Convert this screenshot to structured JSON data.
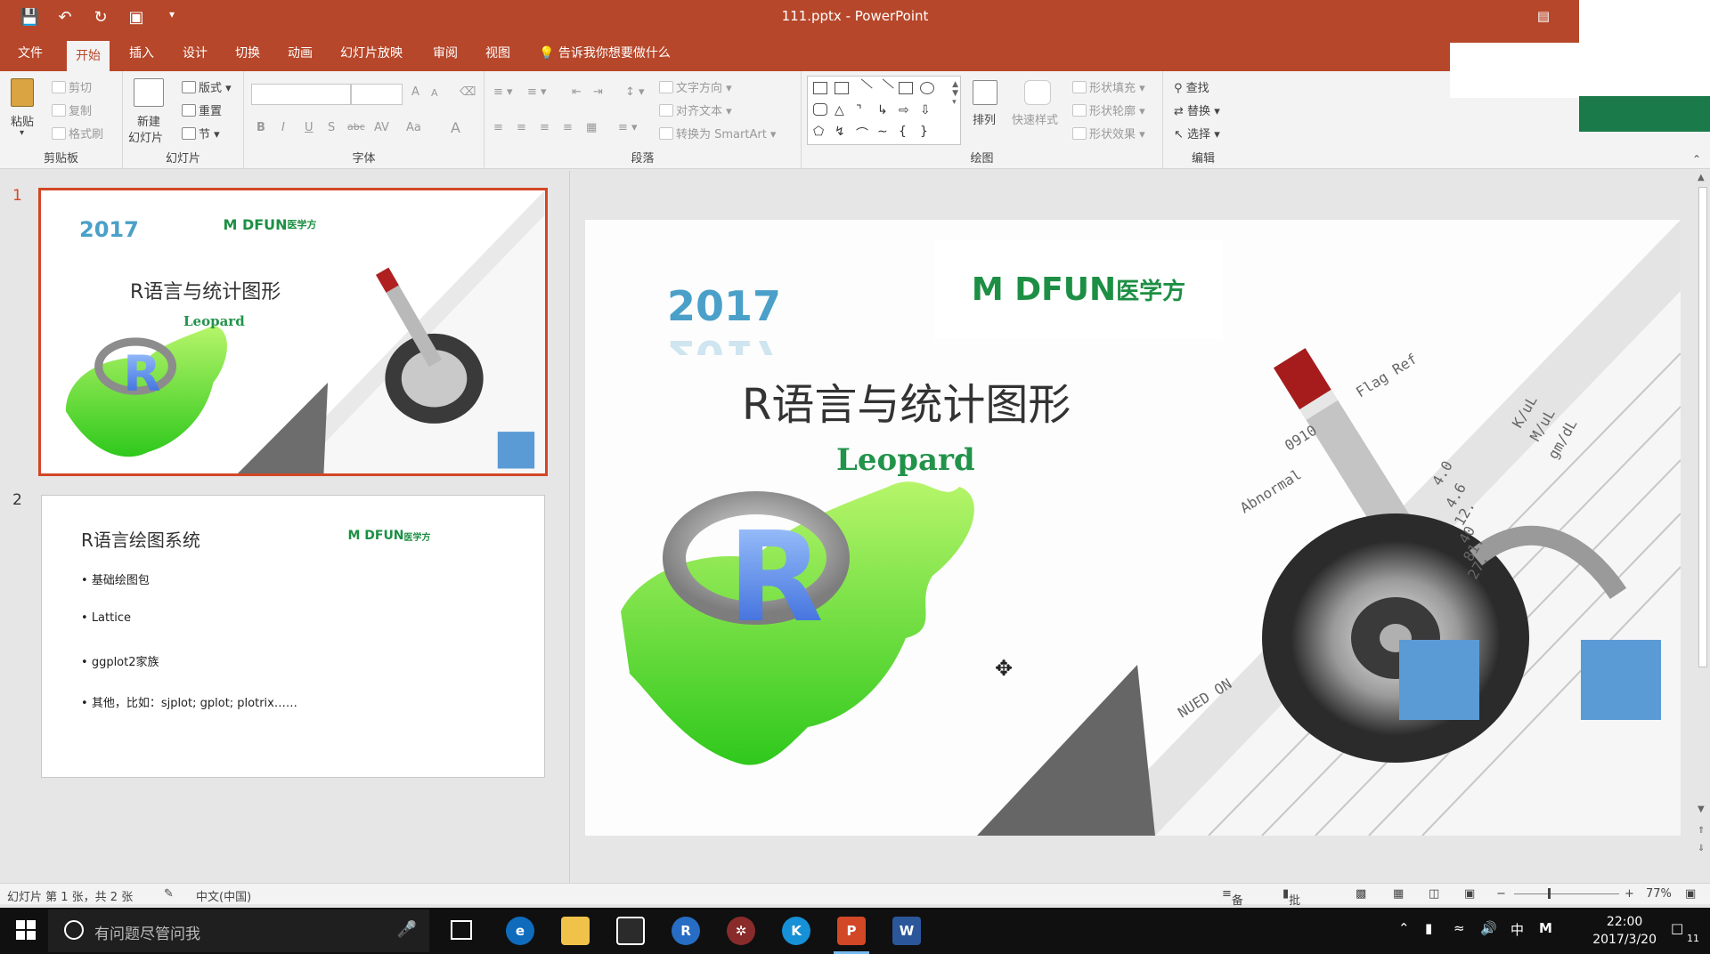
{
  "titlebar": {
    "doc_title": "111.pptx",
    "separator": "-",
    "app_name": "PowerPoint",
    "restore_icon": "ribbon-display-icon"
  },
  "tabs": [
    "文件",
    "开始",
    "插入",
    "设计",
    "切换",
    "动画",
    "幻灯片放映",
    "审阅",
    "视图"
  ],
  "active_tab": "开始",
  "tell_me": "告诉我你想要做什么",
  "ribbon": {
    "clipboard": {
      "paste": "粘贴",
      "cut": "剪切",
      "copy": "复制",
      "format_painter": "格式刷",
      "label": "剪贴板"
    },
    "slides": {
      "new_slide": "新建",
      "new_slide2": "幻灯片",
      "layout": "版式",
      "reset": "重置",
      "section": "节",
      "label": "幻灯片"
    },
    "font": {
      "label": "字体",
      "bold": "B",
      "italic": "I",
      "underline": "U",
      "shadow": "S",
      "strike": "abc",
      "spacing": "AV",
      "case": "Aa",
      "grow": "A",
      "shrink": "A",
      "color": "A"
    },
    "paragraph": {
      "text_direction": "文字方向",
      "align_text": "对齐文本",
      "smartart": "转换为 SmartArt",
      "label": "段落"
    },
    "drawing": {
      "arrange": "排列",
      "quick_styles": "快速样式",
      "shape_fill": "形状填充",
      "shape_outline": "形状轮廓",
      "shape_effects": "形状效果",
      "label": "绘图"
    },
    "editing": {
      "find": "查找",
      "replace": "替换",
      "select": "选择",
      "label": "编辑"
    }
  },
  "thumbnails": [
    {
      "number": "1",
      "selected": true
    },
    {
      "number": "2",
      "selected": false
    }
  ],
  "slide1": {
    "year": "2017",
    "title": "R语言与统计图形",
    "author": "Leopard",
    "logo_text": "M DFUN",
    "logo_cn": "医学方",
    "r_letter": "R",
    "paper_texts": [
      "0910",
      "Flag Ref",
      "Abnormal",
      "K/uL",
      "M/uL",
      "gm/dL",
      "4.0",
      "4.6",
      "12.",
      "40",
      "81.",
      "27.",
      "NUED ON"
    ]
  },
  "slide2": {
    "title": "R语言绘图系统",
    "logo_text": "M DFUN",
    "logo_cn": "医学方",
    "bullets": [
      "基础绘图包",
      "Lattice",
      "ggplot2家族",
      "其他，比如：sjplot; gplot; plotrix……"
    ]
  },
  "statusbar": {
    "slide_info": "幻灯片 第 1 张，共 2 张",
    "language": "中文(中国)",
    "notes": "备注",
    "comments": "批注",
    "zoom_minus": "−",
    "zoom_plus": "+",
    "zoom": "77%"
  },
  "taskbar": {
    "search_placeholder": "有问题尽管问我",
    "clock_time": "22:00",
    "clock_date": "2017/3/20",
    "ime": "中",
    "notif_count": "11",
    "app_letters": {
      "r": "R",
      "k": "K",
      "ppt": "P",
      "word": "W"
    }
  },
  "colors": {
    "accent": "#b7472a",
    "selection": "#d24726",
    "logo_green": "#1d8f44",
    "year_blue": "#4aa0c8",
    "box_blue": "#5b9bd5",
    "flag_green": "#1a7a4a"
  }
}
